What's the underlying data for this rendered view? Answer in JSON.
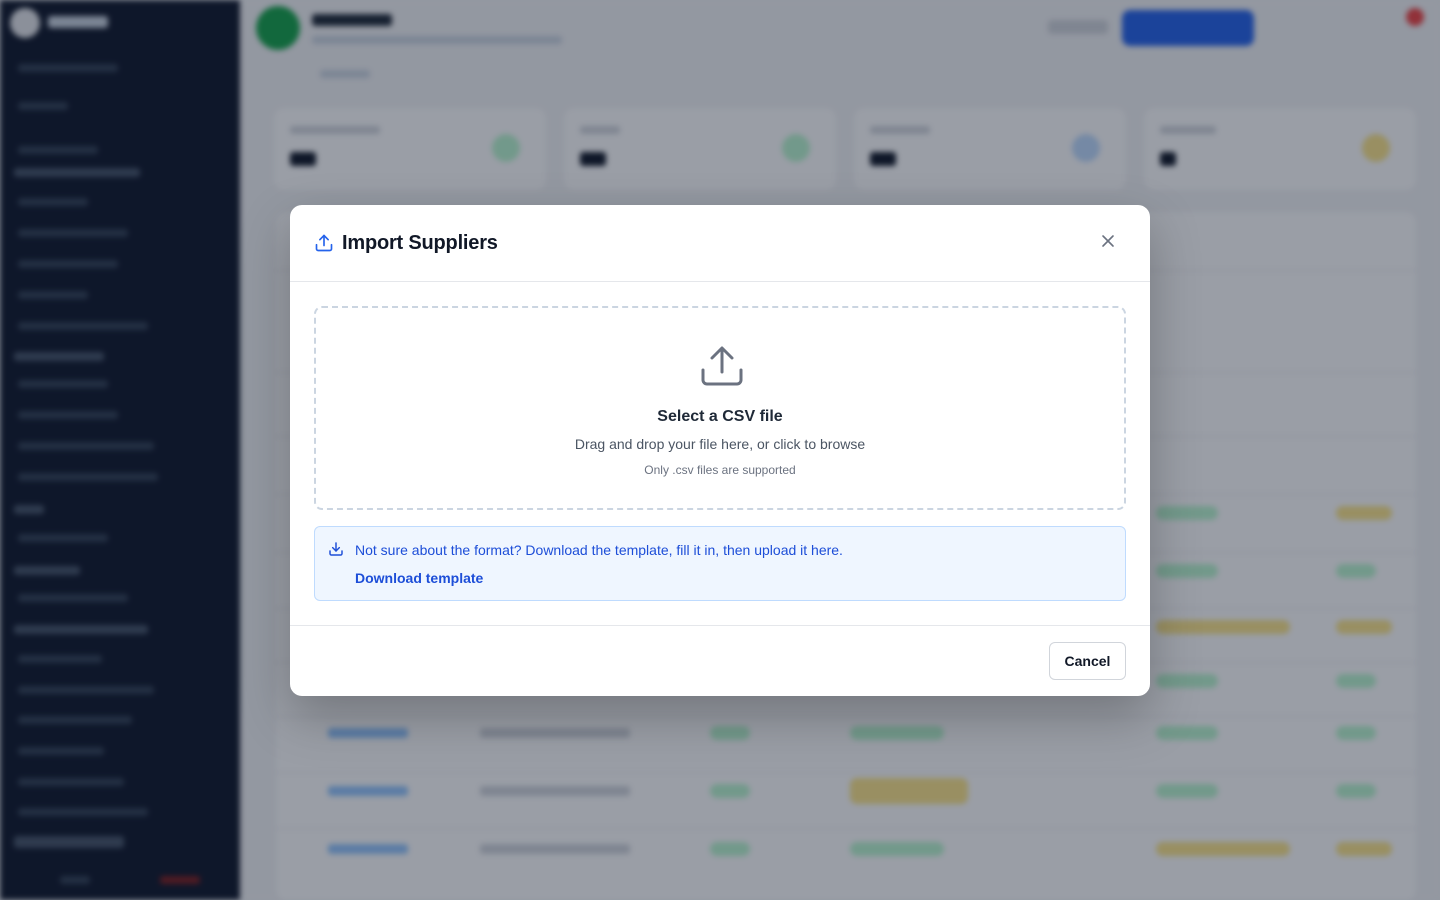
{
  "modal": {
    "title": "Import Suppliers",
    "dropzone": {
      "title": "Select a CSV file",
      "subtitle": "Drag and drop your file here, or click to browse",
      "note": "Only .csv files are supported"
    },
    "info": {
      "text": "Not sure about the format? Download the template, fill it in, then upload it here.",
      "link_label": "Download template"
    },
    "footer": {
      "cancel_label": "Cancel"
    }
  },
  "colors": {
    "accent": "#1d4ed8",
    "info_background": "#eff6ff",
    "overlay": "rgba(15, 23, 42, 0.42)",
    "sidebar": "#0f172a"
  },
  "icons": {
    "header": "upload-icon",
    "close": "close-icon",
    "dropzone": "upload-icon",
    "info": "download-icon"
  }
}
